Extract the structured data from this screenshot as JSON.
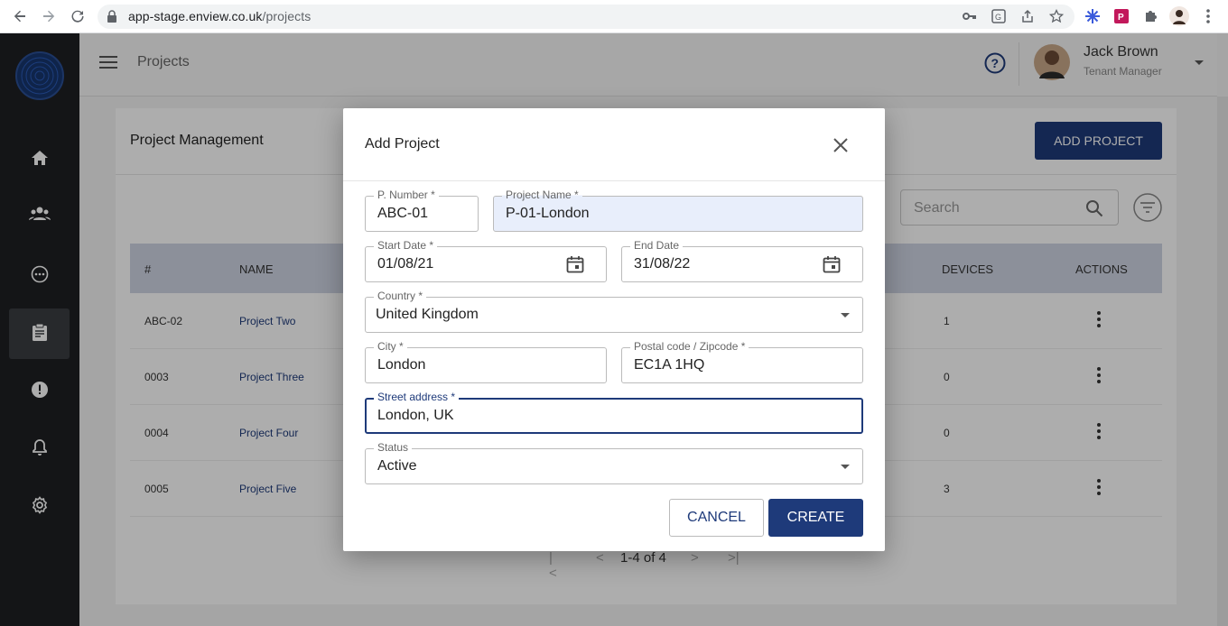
{
  "browser": {
    "url_host": "app-stage.enview.co.uk",
    "url_path": "/projects"
  },
  "header": {
    "page_title": "Projects",
    "user_name": "Jack Brown",
    "user_role": "Tenant Manager"
  },
  "sidebar": {
    "items": [
      {
        "icon": "home-icon",
        "active": false
      },
      {
        "icon": "users-icon",
        "active": false
      },
      {
        "icon": "devices-icon",
        "active": false
      },
      {
        "icon": "clipboard-icon",
        "active": true
      },
      {
        "icon": "alert-icon",
        "active": false
      },
      {
        "icon": "bell-icon",
        "active": false
      },
      {
        "icon": "gear-icon",
        "active": false
      }
    ]
  },
  "card": {
    "title": "Project Management",
    "add_button": "ADD PROJECT",
    "search_placeholder": "Search"
  },
  "table": {
    "columns": {
      "num": "#",
      "name": "NAME",
      "devices": "DEVICES",
      "actions": "ACTIONS"
    },
    "rows": [
      {
        "num": "ABC-02",
        "name": "Project Two",
        "devices": "1"
      },
      {
        "num": "0003",
        "name": "Project Three",
        "devices": "0"
      },
      {
        "num": "0004",
        "name": "Project Four",
        "devices": "0"
      },
      {
        "num": "0005",
        "name": "Project Five",
        "devices": "3"
      }
    ]
  },
  "pagination": {
    "text": "1-4 of 4"
  },
  "modal": {
    "title": "Add Project",
    "fields": {
      "p_number": {
        "label": "P. Number *",
        "value": "ABC-01"
      },
      "project_name": {
        "label": "Project Name *",
        "value": "P-01-London"
      },
      "start_date": {
        "label": "Start Date *",
        "value": "01/08/21"
      },
      "end_date": {
        "label": "End Date",
        "value": "31/08/22"
      },
      "country": {
        "label": "Country *",
        "value": "United Kingdom"
      },
      "city": {
        "label": "City *",
        "value": "London"
      },
      "postal": {
        "label": "Postal code / Zipcode *",
        "value": "EC1A 1HQ"
      },
      "street": {
        "label": "Street address *",
        "value": "London, UK"
      },
      "status": {
        "label": "Status",
        "value": "Active"
      }
    },
    "cancel_label": "CANCEL",
    "create_label": "CREATE"
  },
  "colors": {
    "primary": "#1e3a7a",
    "sidebar": "#1e2023",
    "table_header": "#cfd5e4"
  }
}
